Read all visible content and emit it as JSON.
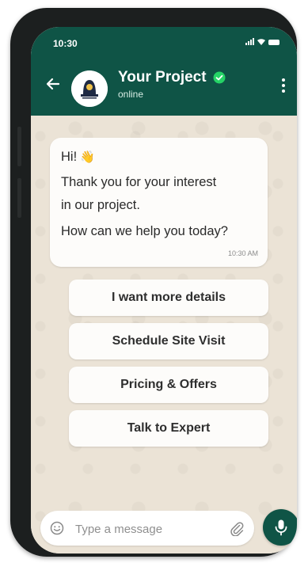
{
  "status_bar": {
    "time": "10:30"
  },
  "header": {
    "title": "Your Project",
    "subtitle": "online",
    "accent_color": "#0f5446",
    "verified_color": "#25d366"
  },
  "message": {
    "line1": "Hi!",
    "line2": "Thank you for your interest",
    "line3": "in our project.",
    "line4": "How can we help you today?",
    "emoji": "👋",
    "time": "10:30 AM"
  },
  "quick_replies": [
    "I want more details",
    "Schedule Site Visit",
    "Pricing & Offers",
    "Talk to Expert"
  ],
  "composer": {
    "placeholder": "Type a message"
  },
  "icons": {
    "back": "arrow-left-icon",
    "verified": "verified-badge-icon",
    "more": "more-vertical-icon",
    "emoji": "emoji-icon",
    "attach": "paperclip-icon",
    "mic": "microphone-icon"
  }
}
